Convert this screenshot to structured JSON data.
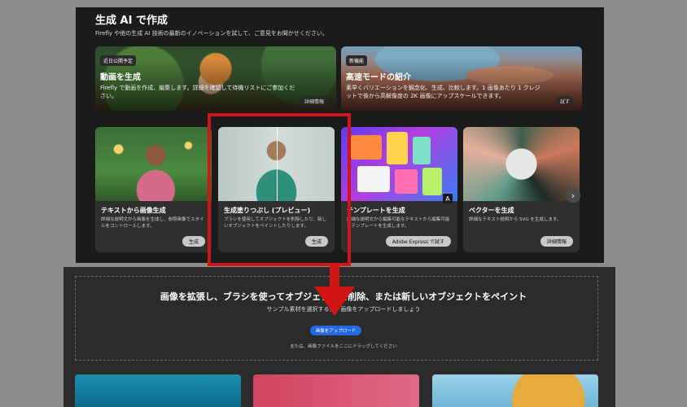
{
  "section": {
    "title": "生成 AI で作成",
    "subtitle": "Firefly や他の生成 AI 技術の最新のイノベーションを試して、ご意見をお聞かせください。"
  },
  "promos": [
    {
      "badge": "近日公開予定",
      "title": "動画を生成",
      "description": "Firefly で動画を作成、編集します。詳細を確認して待機リストにご参加ください。",
      "button": "詳細情報"
    },
    {
      "badge": "新機能",
      "title": "高速モードの紹介",
      "description": "素早くバリエーションを観念化、生成、比較します。1 画像あたり 1 クレジットで後から高解像度の 2K 画像にアップスケールできます。",
      "button": "試す"
    }
  ],
  "cards": [
    {
      "title": "テキストから画像生成",
      "description": "詳細な説明文から画像を生成し、参照画像でスタイルをコントロールします。",
      "button": "生成"
    },
    {
      "title": "生成塗りつぶし (プレビュー)",
      "description": "ブラシを使用してオブジェクトを削除したり、新しいオブジェクトをペイントしたりします。",
      "button": "生成"
    },
    {
      "title": "テンプレートを生成",
      "description": "詳細な説明文から編集可能なテキストから編集可能なテンプレートを生成します。",
      "button": "Adobe Express で試す"
    },
    {
      "title": "ベクターを生成",
      "description": "詳細なテキスト説明から SVG を生成します。",
      "button": "詳細情報"
    }
  ],
  "next_glyph": "›",
  "adobe_logo": "A",
  "upload": {
    "title": "画像を拡張し、ブラシを使ってオブジェクトを削除、または新しいオブジェクトをペイント",
    "subtitle": "サンプル素材を選択するか、画像をアップロードしましょう",
    "button": "画像をアップロード",
    "hint": "または、画像ファイルをここにドラッグしてください"
  },
  "colors": {
    "highlight": "#d11414",
    "upload_button": "#2568e6"
  }
}
